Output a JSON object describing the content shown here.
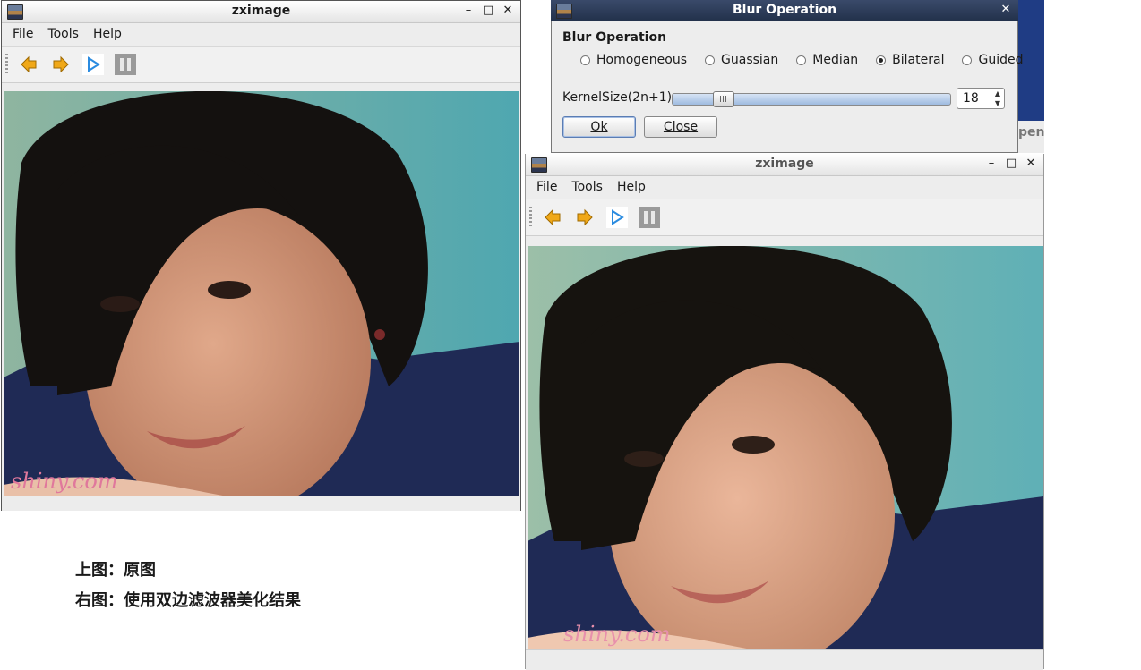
{
  "window_original": {
    "title": "zximage",
    "menu": {
      "file": "File",
      "tools": "Tools",
      "help": "Help"
    }
  },
  "window_result": {
    "title": "zximage",
    "menu": {
      "file": "File",
      "tools": "Tools",
      "help": "Help"
    }
  },
  "toolbar_icons": [
    "previous-arrow-icon",
    "next-arrow-icon",
    "play-icon",
    "pause-icon"
  ],
  "dialog": {
    "title": "Blur Operation",
    "group_title": "Blur Operation",
    "options": [
      "Homogeneous",
      "Guassian",
      "Median",
      "Bilateral",
      "Guided"
    ],
    "selected_option": "Bilateral",
    "kernel_label": "KernelSize(2n+1)",
    "kernel_value": "18",
    "slider_fraction": 0.18,
    "ok_label": "Ok",
    "close_label": "Close"
  },
  "background_window_text": "pend",
  "photo_watermark": "shiny.com",
  "captions": {
    "top": "上图：原图",
    "right": "右图：使用双边滤波器美化结果"
  },
  "colors": {
    "play_blue": "#2a8be0",
    "arrow_orange": "#f0a818",
    "dialog_titlebar": "#2b3a56"
  }
}
